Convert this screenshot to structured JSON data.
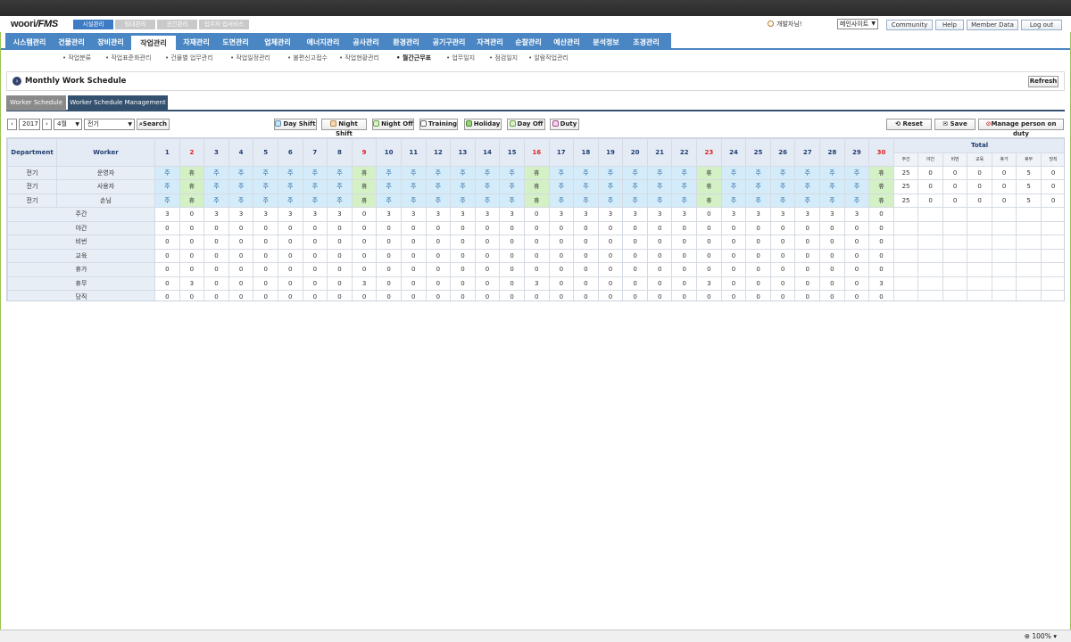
{
  "app": {
    "logo_text": "woori",
    "logo_suffix": "/FMS"
  },
  "top_tabs": [
    "시설관리",
    "임대관리",
    "공간관리",
    "입주자 업서비스"
  ],
  "header": {
    "user_greeting": "개발자님!",
    "site_select": "메인사이트",
    "links": [
      "Community",
      "Help",
      "Member Data",
      "Log out"
    ]
  },
  "main_nav": [
    "시스템관리",
    "건물관리",
    "장비관리",
    "작업관리",
    "자재관리",
    "도면관리",
    "업체관리",
    "에너지관리",
    "공사관리",
    "환경관리",
    "공기구관리",
    "자격관리",
    "순찰관리",
    "예산관리",
    "분석정보",
    "조경관리"
  ],
  "main_nav_active": 3,
  "sub_nav": [
    "작업분류",
    "작업표준화관리",
    "건물별 업무관리",
    "작업일정관리",
    "불편신고접수",
    "작업현황관리",
    "월간근무표",
    "업무일지",
    "점검일지",
    "알람작업관리"
  ],
  "sub_nav_active": 6,
  "page": {
    "title": "Monthly Work Schedule",
    "refresh_label": "Refresh"
  },
  "tabs": [
    "Worker Schedule",
    "Worker Schedule Management"
  ],
  "toolbar": {
    "year": "2017",
    "month": "4월",
    "department": "전기",
    "search_label": "Search",
    "shift_buttons": [
      {
        "label": "Day Shift",
        "color": "#c7e6f8"
      },
      {
        "label": "Night Shift",
        "color": "#f6d9b9"
      },
      {
        "label": "Night Off",
        "color": "#d9f2c7"
      },
      {
        "label": "Training",
        "color": "#ffffff"
      },
      {
        "label": "Holiday",
        "color": "#9ad37a"
      },
      {
        "label": "Day Off",
        "color": "#d9f2c7"
      },
      {
        "label": "Duty",
        "color": "#f3d4ec"
      }
    ],
    "reset_label": "Reset",
    "save_label": "Save",
    "manage_label": "Manage person on duty"
  },
  "grid": {
    "col_department": "Department",
    "col_worker": "Worker",
    "col_total": "Total",
    "days": 30,
    "red_days": [
      2,
      9,
      16,
      23,
      30
    ],
    "total_sub": [
      "주간",
      "야간",
      "비번",
      "교육",
      "휴가",
      "휴무",
      "당직"
    ],
    "day_code": "주",
    "holiday_code": "휴",
    "workers": [
      {
        "dept": "전기",
        "name": "운영자",
        "totals": [
          25,
          0,
          0,
          0,
          0,
          5,
          0
        ]
      },
      {
        "dept": "전기",
        "name": "사용자",
        "totals": [
          25,
          0,
          0,
          0,
          0,
          5,
          0
        ]
      },
      {
        "dept": "전기",
        "name": "손님",
        "totals": [
          25,
          0,
          0,
          0,
          0,
          5,
          0
        ]
      }
    ],
    "summary_rows": [
      {
        "label": "주간",
        "values": [
          3,
          0,
          3,
          3,
          3,
          3,
          3,
          3,
          0,
          3,
          3,
          3,
          3,
          3,
          3,
          0,
          3,
          3,
          3,
          3,
          3,
          3,
          0,
          3,
          3,
          3,
          3,
          3,
          3,
          0
        ]
      },
      {
        "label": "야간",
        "values": [
          0,
          0,
          0,
          0,
          0,
          0,
          0,
          0,
          0,
          0,
          0,
          0,
          0,
          0,
          0,
          0,
          0,
          0,
          0,
          0,
          0,
          0,
          0,
          0,
          0,
          0,
          0,
          0,
          0,
          0
        ]
      },
      {
        "label": "비번",
        "values": [
          0,
          0,
          0,
          0,
          0,
          0,
          0,
          0,
          0,
          0,
          0,
          0,
          0,
          0,
          0,
          0,
          0,
          0,
          0,
          0,
          0,
          0,
          0,
          0,
          0,
          0,
          0,
          0,
          0,
          0
        ]
      },
      {
        "label": "교육",
        "values": [
          0,
          0,
          0,
          0,
          0,
          0,
          0,
          0,
          0,
          0,
          0,
          0,
          0,
          0,
          0,
          0,
          0,
          0,
          0,
          0,
          0,
          0,
          0,
          0,
          0,
          0,
          0,
          0,
          0,
          0
        ]
      },
      {
        "label": "휴가",
        "values": [
          0,
          0,
          0,
          0,
          0,
          0,
          0,
          0,
          0,
          0,
          0,
          0,
          0,
          0,
          0,
          0,
          0,
          0,
          0,
          0,
          0,
          0,
          0,
          0,
          0,
          0,
          0,
          0,
          0,
          0
        ]
      },
      {
        "label": "휴무",
        "values": [
          0,
          3,
          0,
          0,
          0,
          0,
          0,
          0,
          3,
          0,
          0,
          0,
          0,
          0,
          0,
          3,
          0,
          0,
          0,
          0,
          0,
          0,
          3,
          0,
          0,
          0,
          0,
          0,
          0,
          3
        ]
      },
      {
        "label": "당직",
        "values": [
          0,
          0,
          0,
          0,
          0,
          0,
          0,
          0,
          0,
          0,
          0,
          0,
          0,
          0,
          0,
          0,
          0,
          0,
          0,
          0,
          0,
          0,
          0,
          0,
          0,
          0,
          0,
          0,
          0,
          0
        ]
      }
    ]
  },
  "status": {
    "zoom": "100%"
  }
}
